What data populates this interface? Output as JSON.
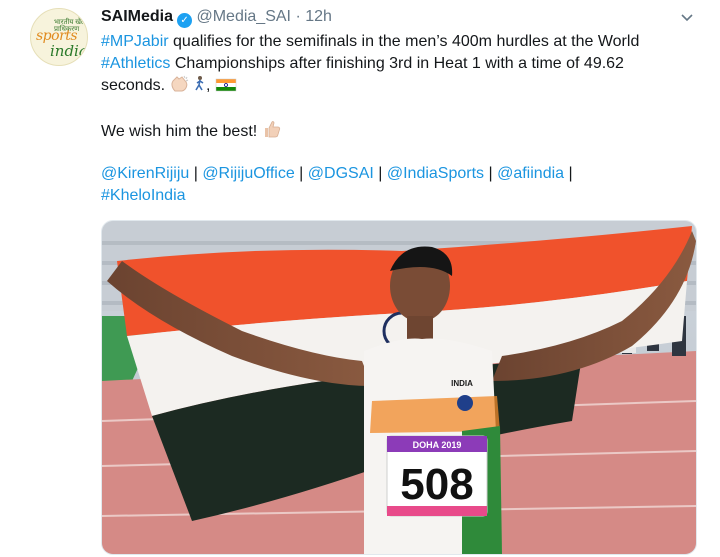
{
  "tweet": {
    "display_name": "SAIMedia",
    "handle": "@Media_SAI",
    "separator": "·",
    "time": "12h",
    "avatar_text": {
      "top": "भारतीय खेल प्राधिकरण",
      "sports": "sports",
      "india": "india"
    },
    "lines": [
      {
        "tag": "#MPJabir",
        "text": " qualifies for the semifinals in the men’s 400m hurdles at the World"
      },
      {
        "tag": "#Athletics",
        "text": " Championships after finishing 3rd in Heat 1 with a time of 49.62"
      },
      {
        "text": "seconds."
      }
    ],
    "wish": "We wish him the best!",
    "mentions": [
      "@KirenRijiju",
      "@RijijuOffice",
      "@DGSAI",
      "@IndiaSports",
      "@afiindia"
    ],
    "mention_separator": " | ",
    "last_tag": "#KheloIndia",
    "bib_number": "508",
    "bib_sponsor": "DOHA 2019",
    "vest_text": "INDIA"
  },
  "colors": {
    "link": "#1b95e0",
    "verified": "#1da1f2",
    "muted": "#657786",
    "text": "#14171a"
  },
  "icons": [
    "verified-badge-icon",
    "chevron-down-icon",
    "clapping-hands-emoji",
    "runner-emoji",
    "india-flag-emoji",
    "thumbs-up-emoji"
  ]
}
